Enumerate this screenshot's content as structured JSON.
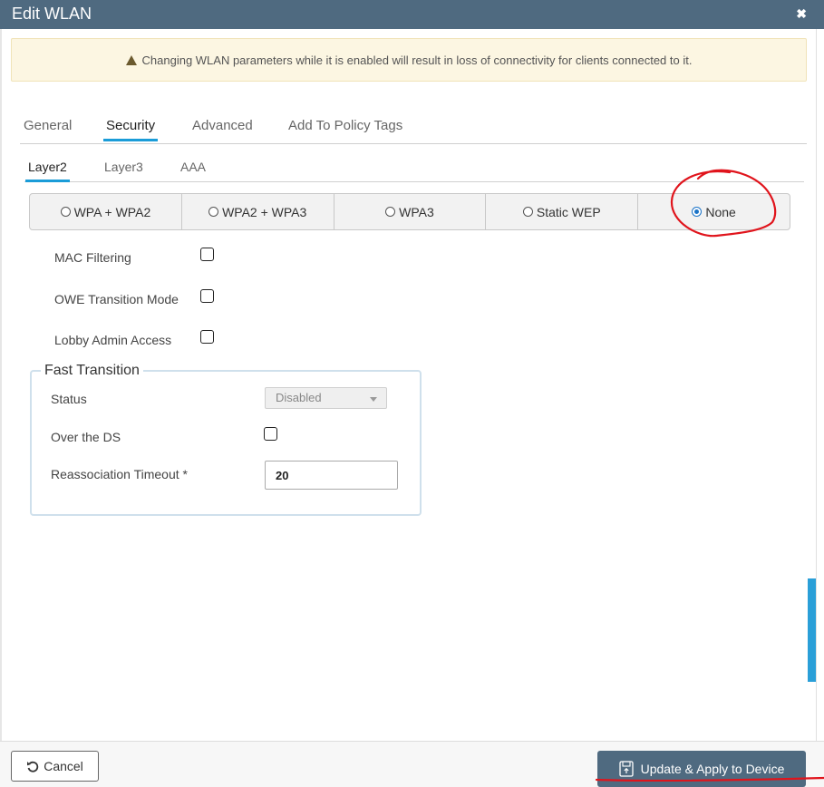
{
  "dialog": {
    "title": "Edit WLAN",
    "close_symbol": "✖"
  },
  "warning": {
    "text": "Changing WLAN parameters while it is enabled will result in loss of connectivity for clients connected to it.",
    "icon": "warning-triangle-icon"
  },
  "tabs": [
    {
      "label": "General",
      "active": false
    },
    {
      "label": "Security",
      "active": true
    },
    {
      "label": "Advanced",
      "active": false
    },
    {
      "label": "Add To Policy Tags",
      "active": false
    }
  ],
  "subtabs": [
    {
      "label": "Layer2",
      "active": true
    },
    {
      "label": "Layer3",
      "active": false
    },
    {
      "label": "AAA",
      "active": false
    }
  ],
  "security_modes": {
    "options": [
      "WPA + WPA2",
      "WPA2 + WPA3",
      "WPA3",
      "Static WEP",
      "None"
    ],
    "selected": "None"
  },
  "checks": {
    "mac_filtering": {
      "label": "MAC Filtering",
      "checked": false
    },
    "owe_transition": {
      "label": "OWE Transition Mode",
      "checked": false
    },
    "lobby_admin": {
      "label": "Lobby Admin Access",
      "checked": false
    }
  },
  "fast_transition": {
    "legend": "Fast Transition",
    "status_label": "Status",
    "status_value": "Disabled",
    "over_ds_label": "Over the DS",
    "over_ds_checked": false,
    "reassoc_label": "Reassociation Timeout *",
    "reassoc_value": "20"
  },
  "footer": {
    "cancel_label": "Cancel",
    "apply_label": "Update & Apply to Device"
  },
  "colors": {
    "header": "#4f6a80",
    "accent": "#1a9cd8",
    "annotation": "#e0141c"
  }
}
